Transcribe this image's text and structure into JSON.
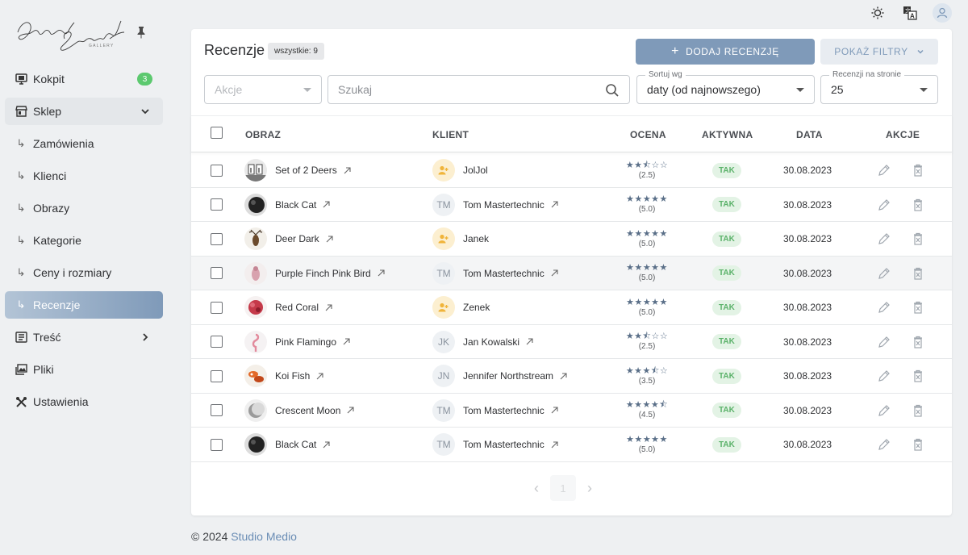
{
  "brand": {
    "logo_text": "Joanna Szmerdt",
    "logo_sub": "GALLERY"
  },
  "sidebar": {
    "items": [
      {
        "label": "Kokpit",
        "icon": "monitor-icon",
        "badge": "3"
      },
      {
        "label": "Sklep",
        "icon": "store-icon",
        "expanded": true
      },
      {
        "label": "Zamówienia",
        "sub": true
      },
      {
        "label": "Klienci",
        "sub": true
      },
      {
        "label": "Obrazy",
        "sub": true
      },
      {
        "label": "Kategorie",
        "sub": true
      },
      {
        "label": "Ceny i rozmiary",
        "sub": true
      },
      {
        "label": "Recenzje",
        "sub": true,
        "active": true
      },
      {
        "label": "Treść",
        "icon": "document-icon"
      },
      {
        "label": "Pliki",
        "icon": "images-icon"
      },
      {
        "label": "Ustawienia",
        "icon": "tools-icon"
      }
    ]
  },
  "header": {
    "title": "Recenzje",
    "count_label": "wszystkie: 9"
  },
  "toolbar": {
    "add_label": "DODAJ RECENZJĘ",
    "filters_label": "POKAŻ FILTRY",
    "actions_placeholder": "Akcje",
    "search_placeholder": "Szukaj",
    "sort_label": "Sortuj wg",
    "sort_value": "daty (od najnowszego)",
    "per_page_label": "Recenzji na stronie",
    "per_page_value": "25"
  },
  "table": {
    "columns": [
      "OBRAZ",
      "KLIENT",
      "OCENA",
      "AKTYWNA",
      "DATA",
      "AKCJE"
    ],
    "rows": [
      {
        "image": "Set of 2 Deers",
        "client": "JolJol",
        "client_initials": "",
        "stars": "★★★☆☆",
        "stars_html": "★★⯪☆☆",
        "rating": "(2.5)",
        "active": "TAK",
        "date": "30.08.2023"
      },
      {
        "image": "Black Cat",
        "client": "Tom Mastertechnic",
        "client_initials": "TM",
        "stars_html": "★★★★★",
        "rating": "(5.0)",
        "active": "TAK",
        "date": "30.08.2023"
      },
      {
        "image": "Deer Dark",
        "client": "Janek",
        "client_initials": "",
        "stars_html": "★★★★★",
        "rating": "(5.0)",
        "active": "TAK",
        "date": "30.08.2023"
      },
      {
        "image": "Purple Finch Pink Bird",
        "client": "Tom Mastertechnic",
        "client_initials": "TM",
        "stars_html": "★★★★★",
        "rating": "(5.0)",
        "active": "TAK",
        "date": "30.08.2023"
      },
      {
        "image": "Red Coral",
        "client": "Zenek",
        "client_initials": "",
        "stars_html": "★★★★★",
        "rating": "(5.0)",
        "active": "TAK",
        "date": "30.08.2023"
      },
      {
        "image": "Pink Flamingo",
        "client": "Jan Kowalski",
        "client_initials": "JK",
        "stars_html": "★★⯪☆☆",
        "rating": "(2.5)",
        "active": "TAK",
        "date": "30.08.2023"
      },
      {
        "image": "Koi Fish",
        "client": "Jennifer Northstream",
        "client_initials": "JN",
        "stars_html": "★★★⯪☆",
        "rating": "(3.5)",
        "active": "TAK",
        "date": "30.08.2023"
      },
      {
        "image": "Crescent Moon",
        "client": "Tom Mastertechnic",
        "client_initials": "TM",
        "stars_html": "★★★★⯪",
        "rating": "(4.5)",
        "active": "TAK",
        "date": "30.08.2023"
      },
      {
        "image": "Black Cat",
        "client": "Tom Mastertechnic",
        "client_initials": "TM",
        "stars_html": "★★★★★",
        "rating": "(5.0)",
        "active": "TAK",
        "date": "30.08.2023"
      }
    ]
  },
  "pagination": {
    "prev": "‹",
    "page": "1",
    "next": "›"
  },
  "footer": {
    "copy": "© 2024",
    "company": "Studio Medio"
  },
  "colors": {
    "accent": "#7f9ab9",
    "success": "#5cc96f",
    "tak_bg": "#e3f3e5"
  }
}
